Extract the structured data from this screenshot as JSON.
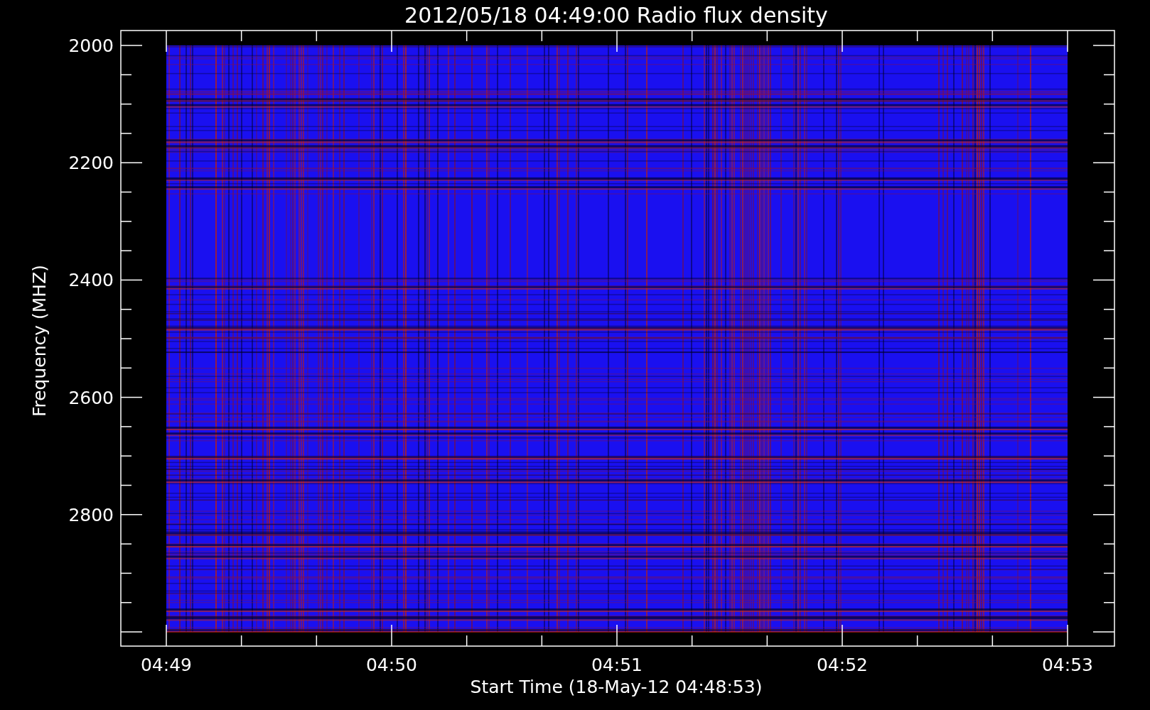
{
  "title": "2012/05/18 04:49:00 Radio flux density",
  "y_axis": {
    "label": "Frequency (MHZ)",
    "tick_labels": [
      "2000",
      "2200",
      "2400",
      "2600",
      "2800"
    ]
  },
  "x_axis": {
    "label": "Start Time (18-May-12 04:48:53)",
    "tick_labels": [
      "04:49",
      "04:50",
      "04:51",
      "04:52",
      "04:53"
    ]
  }
}
